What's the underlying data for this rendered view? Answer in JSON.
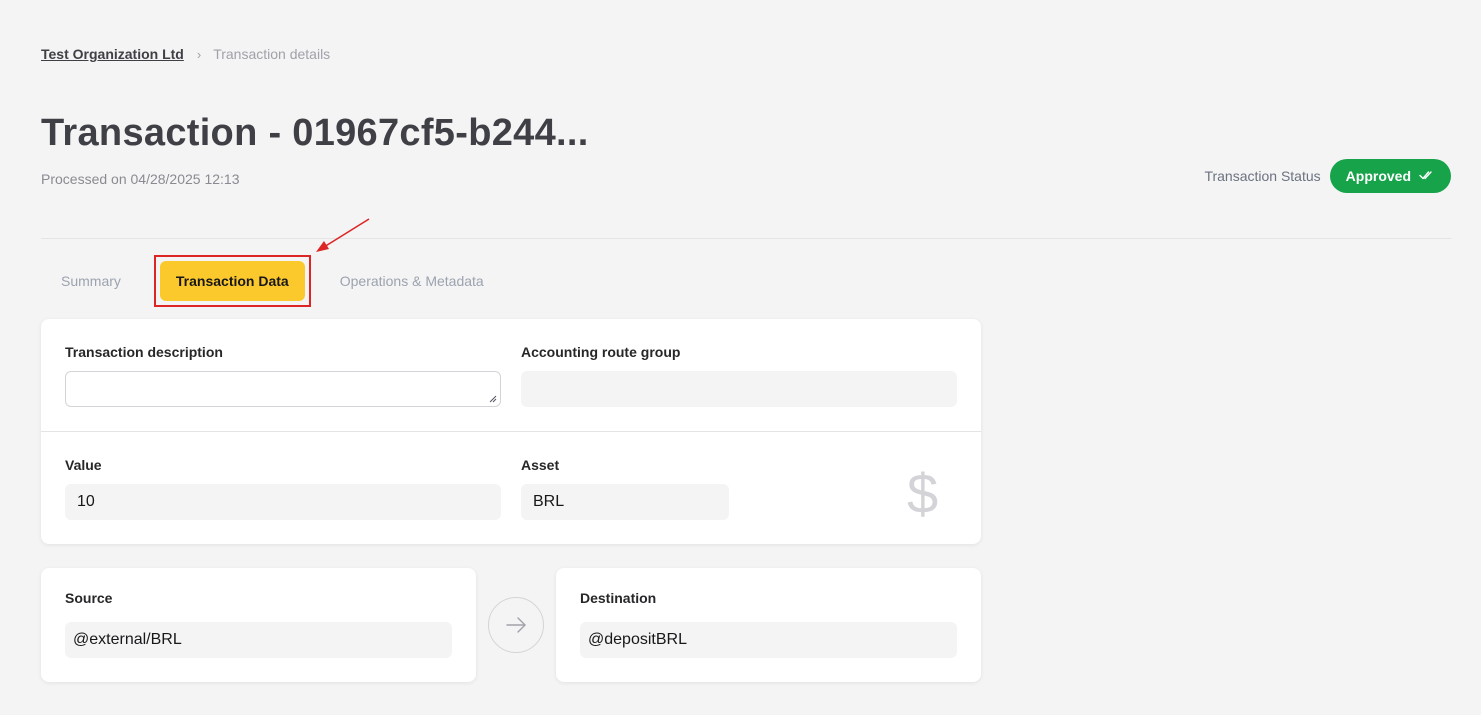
{
  "breadcrumb": {
    "org": "Test Organization Ltd",
    "separator": "›",
    "current": "Transaction details"
  },
  "header": {
    "title": "Transaction - 01967cf5-b244...",
    "processed": "Processed on 04/28/2025 12:13",
    "status_label": "Transaction Status",
    "status_value": "Approved",
    "status_color": "#16a34a"
  },
  "tabs": [
    {
      "label": "Summary",
      "active": false
    },
    {
      "label": "Transaction Data",
      "active": true
    },
    {
      "label": "Operations & Metadata",
      "active": false
    }
  ],
  "form": {
    "description_label": "Transaction description",
    "description_value": "",
    "route_group_label": "Accounting route group",
    "route_group_value": "",
    "value_label": "Value",
    "value_value": "10",
    "asset_label": "Asset",
    "asset_value": "BRL",
    "currency_icon": "$"
  },
  "transfer": {
    "source_label": "Source",
    "source_value": "@external/BRL",
    "destination_label": "Destination",
    "destination_value": "@depositBRL"
  },
  "colors": {
    "accent": "#fcc92c",
    "annotation": "#dc2626"
  }
}
